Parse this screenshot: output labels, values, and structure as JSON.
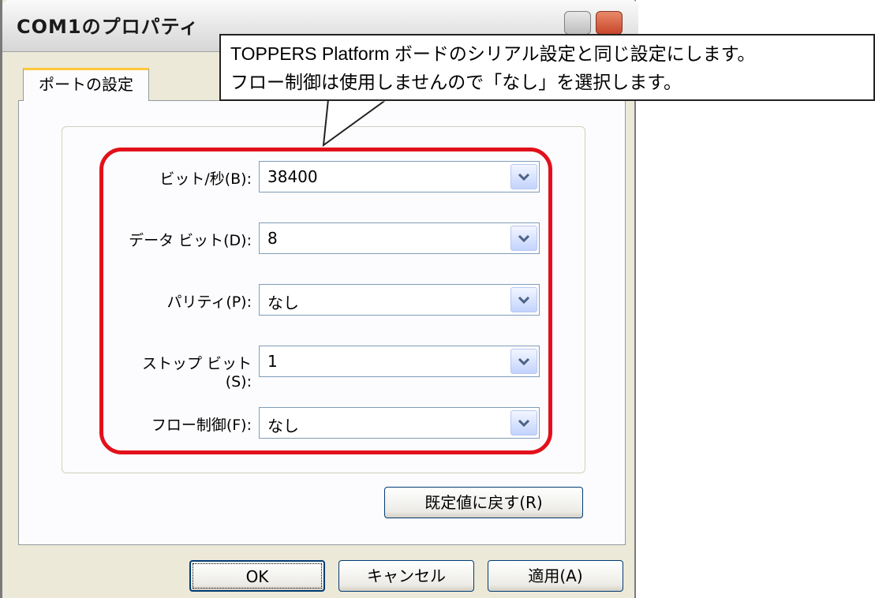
{
  "window": {
    "title": "COM1のプロパティ"
  },
  "tabs": [
    {
      "label": "ポートの設定"
    }
  ],
  "port_settings": [
    {
      "label": "ビット/秒(B):",
      "value": "38400"
    },
    {
      "label": "データ ビット(D):",
      "value": "8"
    },
    {
      "label": "パリティ(P):",
      "value": "なし"
    },
    {
      "label": "ストップ ビット(S):",
      "value": "1"
    },
    {
      "label": "フロー制御(F):",
      "value": "なし"
    }
  ],
  "buttons": {
    "restore_defaults": "既定値に戻す(R)",
    "ok": "OK",
    "cancel": "キャンセル",
    "apply": "適用(A)"
  },
  "callout": {
    "line1": "TOPPERS Platform ボードのシリアル設定と同じ設定にします。",
    "line2": "フロー制御は使用しませんので「なし」を選択します。"
  },
  "colors": {
    "highlight": "#e2101a",
    "tab_accent": "#ffc83c",
    "window_bg": "#ece9d8"
  }
}
